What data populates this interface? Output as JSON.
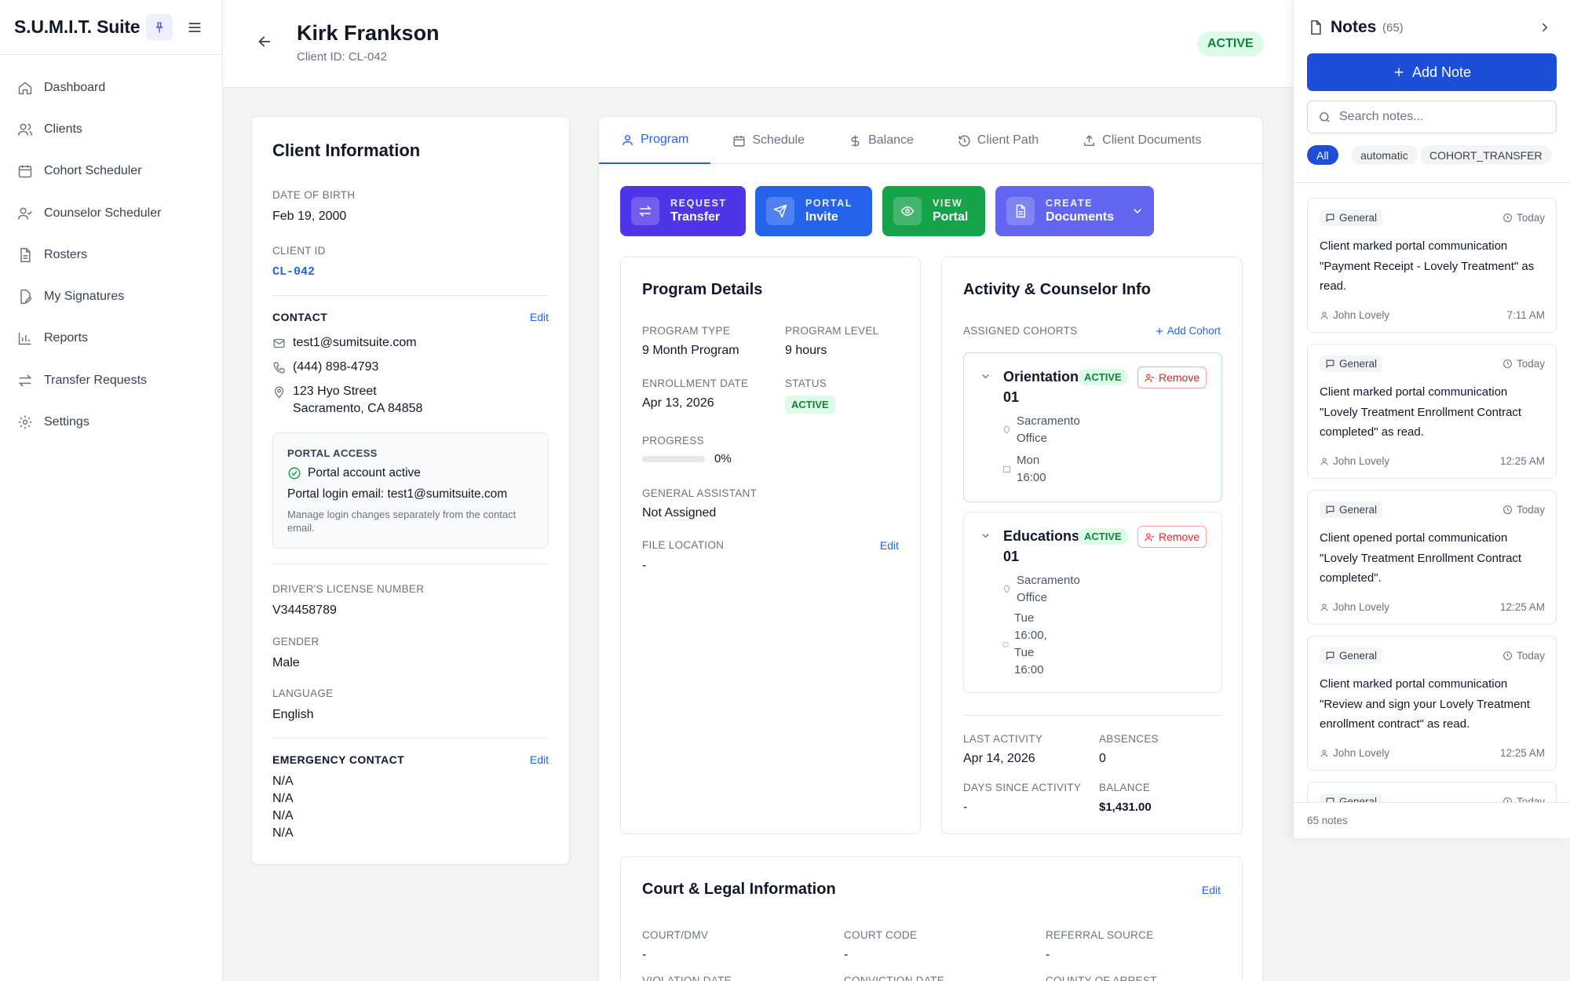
{
  "app": {
    "title": "S.U.M.I.T. Suite"
  },
  "sidebar": {
    "items": [
      {
        "label": "Dashboard",
        "icon": "home-icon"
      },
      {
        "label": "Clients",
        "icon": "users-icon"
      },
      {
        "label": "Cohort Scheduler",
        "icon": "calendar-icon"
      },
      {
        "label": "Counselor Scheduler",
        "icon": "user-check-icon"
      },
      {
        "label": "Rosters",
        "icon": "file-text-icon"
      },
      {
        "label": "My Signatures",
        "icon": "signature-icon"
      },
      {
        "label": "Reports",
        "icon": "bar-chart-icon"
      },
      {
        "label": "Transfer Requests",
        "icon": "arrows-icon"
      },
      {
        "label": "Settings",
        "icon": "gear-icon"
      }
    ]
  },
  "header": {
    "name": "Kirk Frankson",
    "client_id": "Client ID: CL-042",
    "status": "ACTIVE"
  },
  "client_info": {
    "title": "Client Information",
    "dob_label": "DATE OF BIRTH",
    "dob": "Feb 19, 2000",
    "cid_label": "CLIENT ID",
    "cid": "CL-042",
    "contact_label": "CONTACT",
    "edit": "Edit",
    "email": "test1@sumitsuite.com",
    "phone": "(444) 898-4793",
    "address1": "123 Hyo Street",
    "address2": "Sacramento, CA 84858",
    "portal": {
      "label": "PORTAL ACCESS",
      "status": "Portal account active",
      "login_email": "Portal login email: test1@sumitsuite.com",
      "note": "Manage login changes separately from the contact email."
    },
    "license_label": "DRIVER'S LICENSE NUMBER",
    "license": "V34458789",
    "gender_label": "GENDER",
    "gender": "Male",
    "language_label": "LANGUAGE",
    "language": "English",
    "emergency_label": "EMERGENCY CONTACT",
    "emergency": [
      "N/A",
      "N/A",
      "N/A",
      "N/A"
    ]
  },
  "tabs": [
    {
      "label": "Program",
      "icon": "user-icon",
      "active": true
    },
    {
      "label": "Schedule",
      "icon": "calendar-icon"
    },
    {
      "label": "Balance",
      "icon": "dollar-icon"
    },
    {
      "label": "Client Path",
      "icon": "history-icon"
    },
    {
      "label": "Client Documents",
      "icon": "upload-icon"
    }
  ],
  "actions": [
    {
      "top": "REQUEST",
      "bottom": "Transfer",
      "color": "#4f35e8"
    },
    {
      "top": "PORTAL",
      "bottom": "Invite",
      "color": "#2563eb"
    },
    {
      "top": "VIEW",
      "bottom": "Portal",
      "color": "#16a34a"
    },
    {
      "top": "CREATE",
      "bottom": "Documents",
      "color": "#6366f1"
    }
  ],
  "program": {
    "title": "Program Details",
    "type_label": "PROGRAM TYPE",
    "type": "9 Month Program",
    "level_label": "PROGRAM LEVEL",
    "level": "9 hours",
    "enroll_label": "ENROLLMENT DATE",
    "enroll": "Apr 13, 2026",
    "status_label": "STATUS",
    "status": "ACTIVE",
    "progress_label": "PROGRESS",
    "progress_text": "0%",
    "progress_value": 0,
    "assistant_label": "GENERAL ASSISTANT",
    "assistant": "Not Assigned",
    "file_label": "FILE LOCATION",
    "file": "-",
    "edit": "Edit"
  },
  "activity": {
    "title": "Activity & Counselor Info",
    "cohorts_label": "ASSIGNED COHORTS",
    "add_cohort": "Add Cohort",
    "cohorts": [
      {
        "name1": "Orientation",
        "name2": "01",
        "status": "ACTIVE",
        "remove": "Remove",
        "loc1": "Sacramento",
        "loc2": "Office",
        "time1": "Mon",
        "time2": "16:00"
      },
      {
        "name1": "Educations",
        "name2": "01",
        "status": "ACTIVE",
        "remove": "Remove",
        "loc1": "Sacramento",
        "loc2": "Office",
        "time1": "Tue",
        "time2": "16:00,",
        "time3": "Tue",
        "time4": "16:00"
      }
    ],
    "last_label": "LAST ACTIVITY",
    "last": "Apr 14, 2026",
    "absences_label": "ABSENCES",
    "absences": "0",
    "days_label": "DAYS SINCE ACTIVITY",
    "days": "-",
    "balance_label": "BALANCE",
    "balance": "$1,431.00"
  },
  "court": {
    "title": "Court & Legal Information",
    "edit": "Edit",
    "court_label": "COURT/DMV",
    "court": "-",
    "code_label": "COURT CODE",
    "code": "-",
    "referral_label": "REFERRAL SOURCE",
    "referral": "-",
    "violation_label": "VIOLATION DATE",
    "conviction_label": "CONVICTION DATE",
    "county_label": "COUNTY OF ARREST"
  },
  "notes": {
    "title": "Notes",
    "count": "(65)",
    "add": "Add Note",
    "search_placeholder": "Search notes...",
    "filters": [
      "All",
      "automatic",
      "COHORT_TRANSFER"
    ],
    "items": [
      {
        "tag": "General",
        "date": "Today",
        "body": "Client marked portal communication \"Payment Receipt - Lovely Treatment\" as read.",
        "author": "John Lovely",
        "time": "7:11 AM"
      },
      {
        "tag": "General",
        "date": "Today",
        "body": "Client marked portal communication \"Lovely Treatment Enrollment Contract completed\" as read.",
        "author": "John Lovely",
        "time": "12:25 AM"
      },
      {
        "tag": "General",
        "date": "Today",
        "body": "Client opened portal communication \"Lovely Treatment Enrollment Contract completed\".",
        "author": "John Lovely",
        "time": "12:25 AM"
      },
      {
        "tag": "General",
        "date": "Today",
        "body": "Client marked portal communication \"Review and sign your Lovely Treatment enrollment contract\" as read.",
        "author": "John Lovely",
        "time": "12:25 AM"
      },
      {
        "tag": "General",
        "date": "Today"
      }
    ],
    "footer": "65 notes"
  }
}
